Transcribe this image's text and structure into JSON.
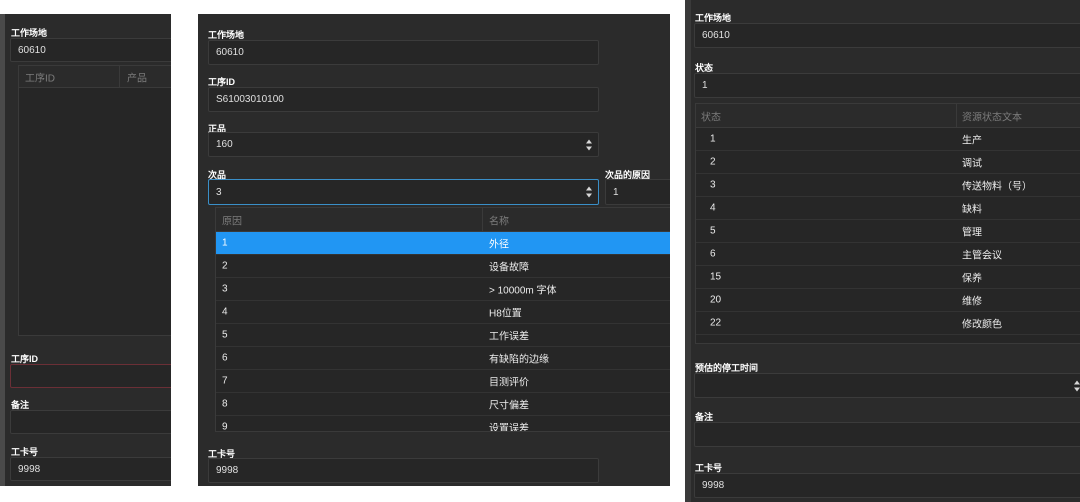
{
  "panel1": {
    "workplace_label": "工作场地",
    "workplace_value": "60610",
    "table_headers": [
      "工序ID",
      "产品"
    ],
    "op_id_label": "工序ID",
    "op_id_value": "",
    "remark_label": "备注",
    "remark_value": "",
    "card_label": "工卡号",
    "card_value": "9998"
  },
  "panel2": {
    "workplace_label": "工作场地",
    "workplace_value": "60610",
    "op_id_label": "工序ID",
    "op_id_value": "S61003010100",
    "good_label": "正品",
    "good_value": "160",
    "defect_label": "次品",
    "defect_value": "3",
    "reason_label": "次品的原因",
    "reason_value": "1",
    "dropdown_headers": [
      "原因",
      "名称"
    ],
    "dropdown_rows": [
      {
        "code": "1",
        "name": "外径"
      },
      {
        "code": "2",
        "name": "设备故障"
      },
      {
        "code": "3",
        "name": "> 10000m 字体"
      },
      {
        "code": "4",
        "name": "H8位置"
      },
      {
        "code": "5",
        "name": "工作误差"
      },
      {
        "code": "6",
        "name": "有缺陷的边缘"
      },
      {
        "code": "7",
        "name": "目测评价"
      },
      {
        "code": "8",
        "name": "尺寸偏差"
      },
      {
        "code": "9",
        "name": "设置误差"
      }
    ],
    "card_label": "工卡号",
    "card_value": "9998"
  },
  "panel3": {
    "workplace_label": "工作场地",
    "workplace_value": "60610",
    "status_label": "状态",
    "status_value": "1",
    "table_headers": [
      "状态",
      "资源状态文本"
    ],
    "table_rows": [
      {
        "code": "1",
        "text": "生产"
      },
      {
        "code": "2",
        "text": "调试"
      },
      {
        "code": "3",
        "text": "传送物料（号）"
      },
      {
        "code": "4",
        "text": "缺料"
      },
      {
        "code": "5",
        "text": "管理"
      },
      {
        "code": "6",
        "text": "主管会议"
      },
      {
        "code": "15",
        "text": "保养"
      },
      {
        "code": "20",
        "text": "维修"
      },
      {
        "code": "22",
        "text": "修改颜色"
      }
    ],
    "downtime_label": "预估的停工时间",
    "downtime_value": "",
    "remark_label": "备注",
    "remark_value": "",
    "card_label": "工卡号",
    "card_value": "9998"
  },
  "colors": {
    "panel_bg": "#2b2b2b",
    "field_bg": "#262626",
    "selection": "#2196f3",
    "focus_border": "#3a8fc8"
  },
  "icons": {
    "spin": "spinbox-arrows-icon"
  }
}
